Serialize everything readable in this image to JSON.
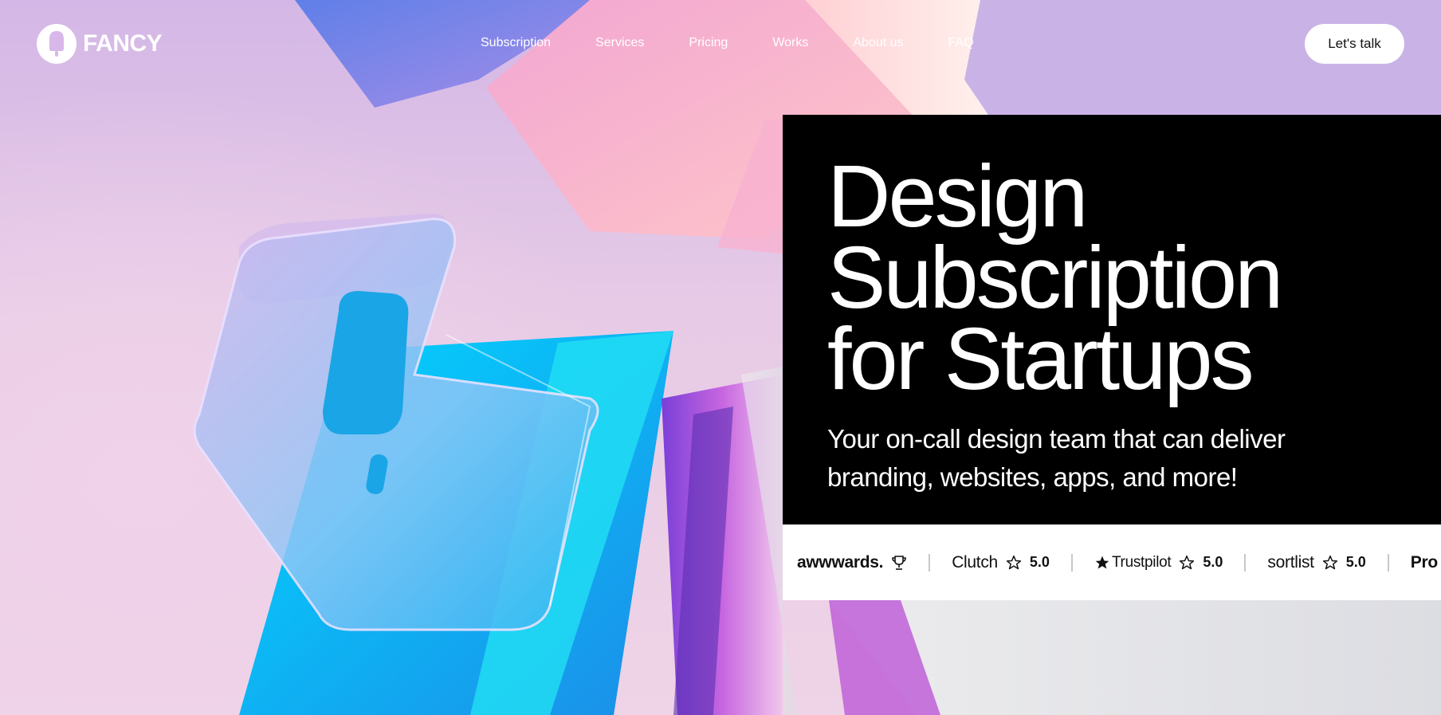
{
  "brand": {
    "name": "FANCY"
  },
  "nav": {
    "items": [
      {
        "label": "Subscription"
      },
      {
        "label": "Services"
      },
      {
        "label": "Pricing"
      },
      {
        "label": "Works"
      },
      {
        "label": "About us"
      },
      {
        "label": "FAQ"
      }
    ],
    "cta_label": "Let's talk"
  },
  "hero": {
    "title_lines": [
      "Design",
      "Subscription",
      "for Startups"
    ],
    "subtitle_lines": [
      "Your on-call design team that can deliver",
      "branding, websites, apps, and more!"
    ]
  },
  "ratings": [
    {
      "brand": "awwwards.",
      "icon": "trophy-icon",
      "score": ""
    },
    {
      "brand": "Clutch",
      "icon": "star-outline-icon",
      "score": "5.0"
    },
    {
      "brand": "Trustpilot",
      "icon": "star-outline-icon",
      "score": "5.0",
      "brand_icon": "star-filled-icon"
    },
    {
      "brand": "sortlist",
      "icon": "star-outline-icon",
      "score": "5.0"
    },
    {
      "brand": "Pro",
      "icon": "",
      "score": ""
    }
  ],
  "colors": {
    "hero_bg": "#000000",
    "accent_blue": "#1aa5e6",
    "background_pink": "#e6c9e4",
    "white": "#ffffff"
  }
}
